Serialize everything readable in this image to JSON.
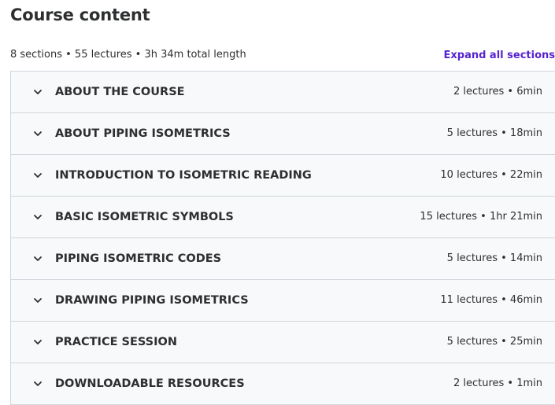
{
  "page": {
    "title": "Course content"
  },
  "summary": {
    "text": "8 sections • 55 lectures • 3h 34m total length",
    "expand_label": "Expand all sections"
  },
  "colors": {
    "accent": "#5624d0",
    "row_background": "#f7f9fa",
    "border": "#d1d7dc",
    "text": "#2d2f31"
  },
  "icons": {
    "section_toggle": "chevron-down-icon"
  },
  "sections": [
    {
      "title": "ABOUT THE COURSE",
      "meta": "2 lectures • 6min"
    },
    {
      "title": "ABOUT PIPING ISOMETRICS",
      "meta": "5 lectures • 18min"
    },
    {
      "title": "INTRODUCTION TO ISOMETRIC READING",
      "meta": "10 lectures • 22min"
    },
    {
      "title": "BASIC ISOMETRIC SYMBOLS",
      "meta": "15 lectures • 1hr 21min"
    },
    {
      "title": "PIPING ISOMETRIC CODES",
      "meta": "5 lectures • 14min"
    },
    {
      "title": "DRAWING PIPING ISOMETRICS",
      "meta": "11 lectures • 46min"
    },
    {
      "title": "PRACTICE SESSION",
      "meta": "5 lectures • 25min"
    },
    {
      "title": "DOWNLOADABLE RESOURCES",
      "meta": "2 lectures • 1min"
    }
  ]
}
